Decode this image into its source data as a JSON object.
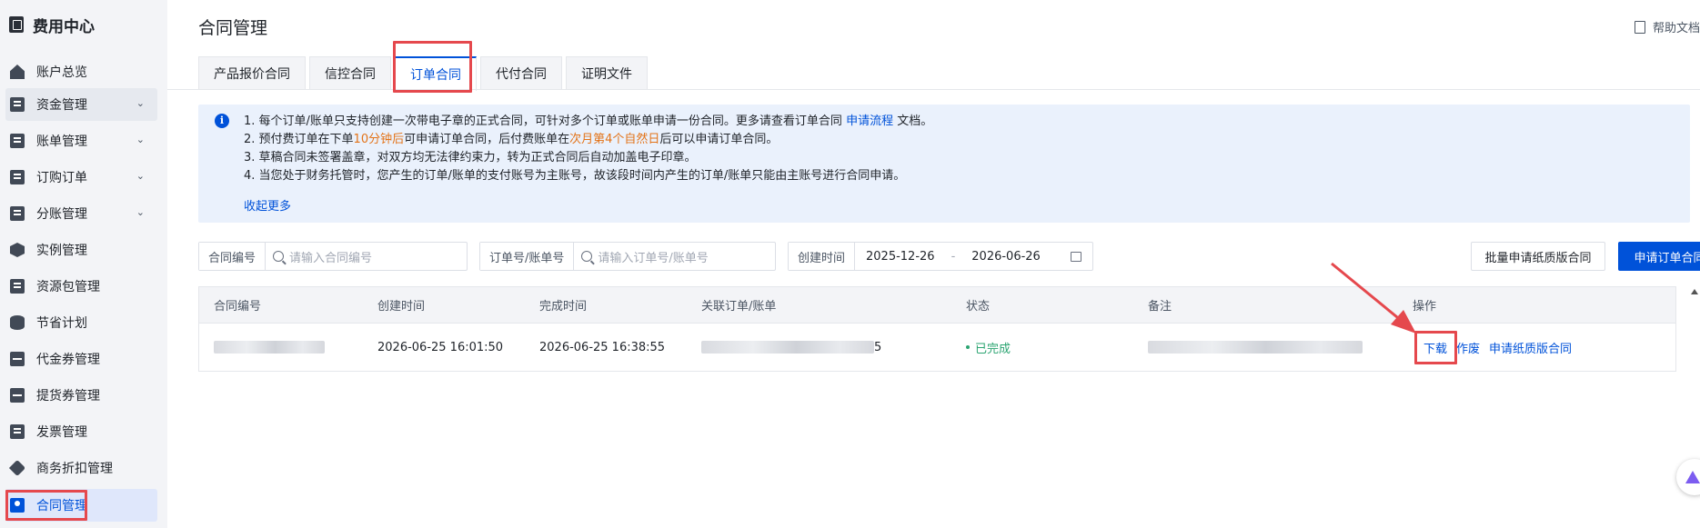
{
  "sidebar": {
    "title": "费用中心",
    "items": [
      {
        "label": "账户总览",
        "expandable": false
      },
      {
        "label": "资金管理",
        "expandable": true
      },
      {
        "label": "账单管理",
        "expandable": true
      },
      {
        "label": "订购订单",
        "expandable": true
      },
      {
        "label": "分账管理",
        "expandable": true
      },
      {
        "label": "实例管理",
        "expandable": false
      },
      {
        "label": "资源包管理",
        "expandable": false
      },
      {
        "label": "节省计划",
        "expandable": false
      },
      {
        "label": "代金券管理",
        "expandable": false
      },
      {
        "label": "提货券管理",
        "expandable": false
      },
      {
        "label": "发票管理",
        "expandable": false
      },
      {
        "label": "商务折扣管理",
        "expandable": false
      },
      {
        "label": "合同管理",
        "expandable": false,
        "active": true
      }
    ]
  },
  "header": {
    "title": "合同管理",
    "help_label": "帮助文档"
  },
  "tabs": [
    {
      "label": "产品报价合同"
    },
    {
      "label": "信控合同"
    },
    {
      "label": "订单合同",
      "active": true
    },
    {
      "label": "代付合同"
    },
    {
      "label": "证明文件"
    }
  ],
  "notice": {
    "line1_a": "1. 每个订单/账单只支持创建一次带电子章的正式合同，可针对多个订单或账单申请一份合同。更多请查看订单合同 ",
    "line1_link": "申请流程",
    "line1_b": " 文档。",
    "line2_a": "2. 预付费订单在下单",
    "line2_hl1": "10分钟后",
    "line2_b": "可申请订单合同，后付费账单在",
    "line2_hl2": "次月第4个自然日",
    "line2_c": "后可以申请订单合同。",
    "line3": "3. 草稿合同未签署盖章，对双方均无法律约束力，转为正式合同后自动加盖电子印章。",
    "line4": "4. 当您处于财务托管时，您产生的订单/账单的支付账号为主账号，故该段时间内产生的订单/账单只能由主账号进行合同申请。",
    "more_label": "收起更多"
  },
  "filters": {
    "contract_no_label": "合同编号",
    "contract_no_placeholder": "请输入合同编号",
    "order_no_label": "订单号/账单号",
    "order_no_placeholder": "请输入订单号/账单号",
    "created_label": "创建时间",
    "date_start": "2025-12-26",
    "date_sep": "-",
    "date_end": "2026-06-26",
    "batch_paper_button": "批量申请纸质版合同",
    "apply_button": "申请订单合同"
  },
  "table": {
    "headers": [
      "合同编号",
      "创建时间",
      "完成时间",
      "关联订单/账单",
      "状态",
      "备注",
      "操作"
    ],
    "rows": [
      {
        "created": "2026-06-25 16:01:50",
        "completed": "2026-06-25 16:38:55",
        "order_suffix": "5",
        "status": "已完成",
        "actions": [
          "下载",
          "作废",
          "申请纸质版合同"
        ]
      }
    ]
  },
  "colors": {
    "primary": "#0052d9",
    "success": "#2ba471",
    "warning": "#e37318",
    "annotation": "#e5484d"
  }
}
